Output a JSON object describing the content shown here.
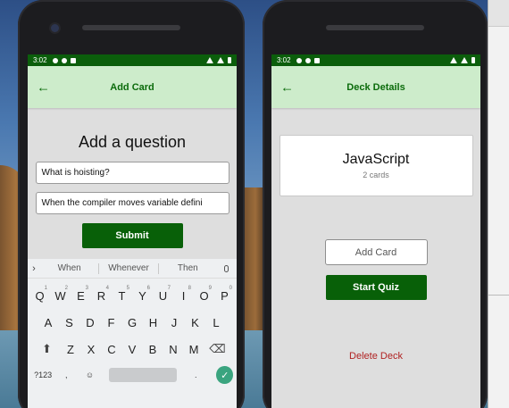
{
  "status": {
    "time": "3:02"
  },
  "add_card": {
    "title": "Add Card",
    "heading": "Add a question",
    "question_value": "What is hoisting?",
    "answer_value": "When the compiler moves variable defini",
    "submit_label": "Submit"
  },
  "keyboard": {
    "suggestions": [
      "When",
      "Whenever",
      "Then"
    ],
    "row1": [
      "Q",
      "W",
      "E",
      "R",
      "T",
      "Y",
      "U",
      "I",
      "O",
      "P"
    ],
    "row1_hints": [
      "1",
      "2",
      "3",
      "4",
      "5",
      "6",
      "7",
      "8",
      "9",
      "0"
    ],
    "row2": [
      "A",
      "S",
      "D",
      "F",
      "G",
      "H",
      "J",
      "K",
      "L"
    ],
    "row3": [
      "Z",
      "X",
      "C",
      "V",
      "B",
      "N",
      "M"
    ],
    "symbols_label": "?123",
    "comma": ",",
    "period": "."
  },
  "deck_details": {
    "title": "Deck Details",
    "deck_name": "JavaScript",
    "card_count": "2 cards",
    "add_card_label": "Add Card",
    "start_quiz_label": "Start Quiz",
    "delete_label": "Delete Deck"
  },
  "colors": {
    "app_bar": "#cdeccb",
    "accent_green": "#086008",
    "status_bar": "#0b5e0b",
    "delete_red": "#b02222"
  },
  "icons": [
    "back-arrow-icon",
    "settings-icon",
    "wifi-icon",
    "battery-icon",
    "mic-icon",
    "shift-icon",
    "backspace-icon",
    "emoji-icon",
    "check-icon"
  ]
}
